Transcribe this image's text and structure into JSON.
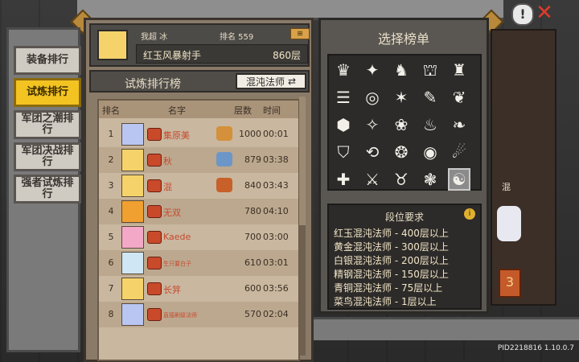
{
  "side_tabs": [
    {
      "label": "装备排行",
      "active": false
    },
    {
      "label": "试炼排行",
      "active": true
    },
    {
      "label": "军团之潮排行",
      "active": false
    },
    {
      "label": "军团决战排行",
      "active": false
    },
    {
      "label": "强者试炼排行",
      "active": false
    }
  ],
  "me": {
    "name": "我超 冰",
    "rank_label": "排名 559",
    "title": "红玉风暴射手",
    "floor": "860层"
  },
  "board": {
    "title": "试炼排行榜",
    "class_button": "混沌法师"
  },
  "list": {
    "headers": {
      "rank": "排名",
      "name": "名字",
      "floor": "层数",
      "time": "时间"
    },
    "rows": [
      {
        "rank": "1",
        "name": "集原美",
        "floor": "1000",
        "time": "00:01"
      },
      {
        "rank": "2",
        "name": "秋",
        "floor": "879",
        "time": "03:38"
      },
      {
        "rank": "3",
        "name": "混",
        "floor": "840",
        "time": "03:43"
      },
      {
        "rank": "4",
        "name": "无双",
        "floor": "780",
        "time": "04:10"
      },
      {
        "rank": "5",
        "name": "Kaede",
        "floor": "700",
        "time": "03:00"
      },
      {
        "rank": "6",
        "name": "生只要白子",
        "floor": "610",
        "time": "03:01"
      },
      {
        "rank": "7",
        "name": "长笄",
        "floor": "600",
        "time": "03:56"
      },
      {
        "rank": "8",
        "name": "直接刷级法师",
        "floor": "570",
        "time": "02:04"
      }
    ]
  },
  "select_panel": {
    "title": "选择榜单",
    "requirements_title": "段位要求",
    "requirements": [
      "红玉混沌法师 - 400层以上",
      "黄金混沌法师 - 300层以上",
      "白银混沌法师 - 200层以上",
      "精钢混沌法师 - 150层以上",
      "青铜混沌法师 - 75层以上",
      "菜鸟混沌法师 - 1层以上"
    ]
  },
  "deco": {
    "label": "混",
    "badge": "3"
  },
  "footer": {
    "pid": "PID2218816 1.10.0.7"
  },
  "colors": {
    "active_tab": "#f3c321",
    "name_red": "#c74a2e"
  }
}
